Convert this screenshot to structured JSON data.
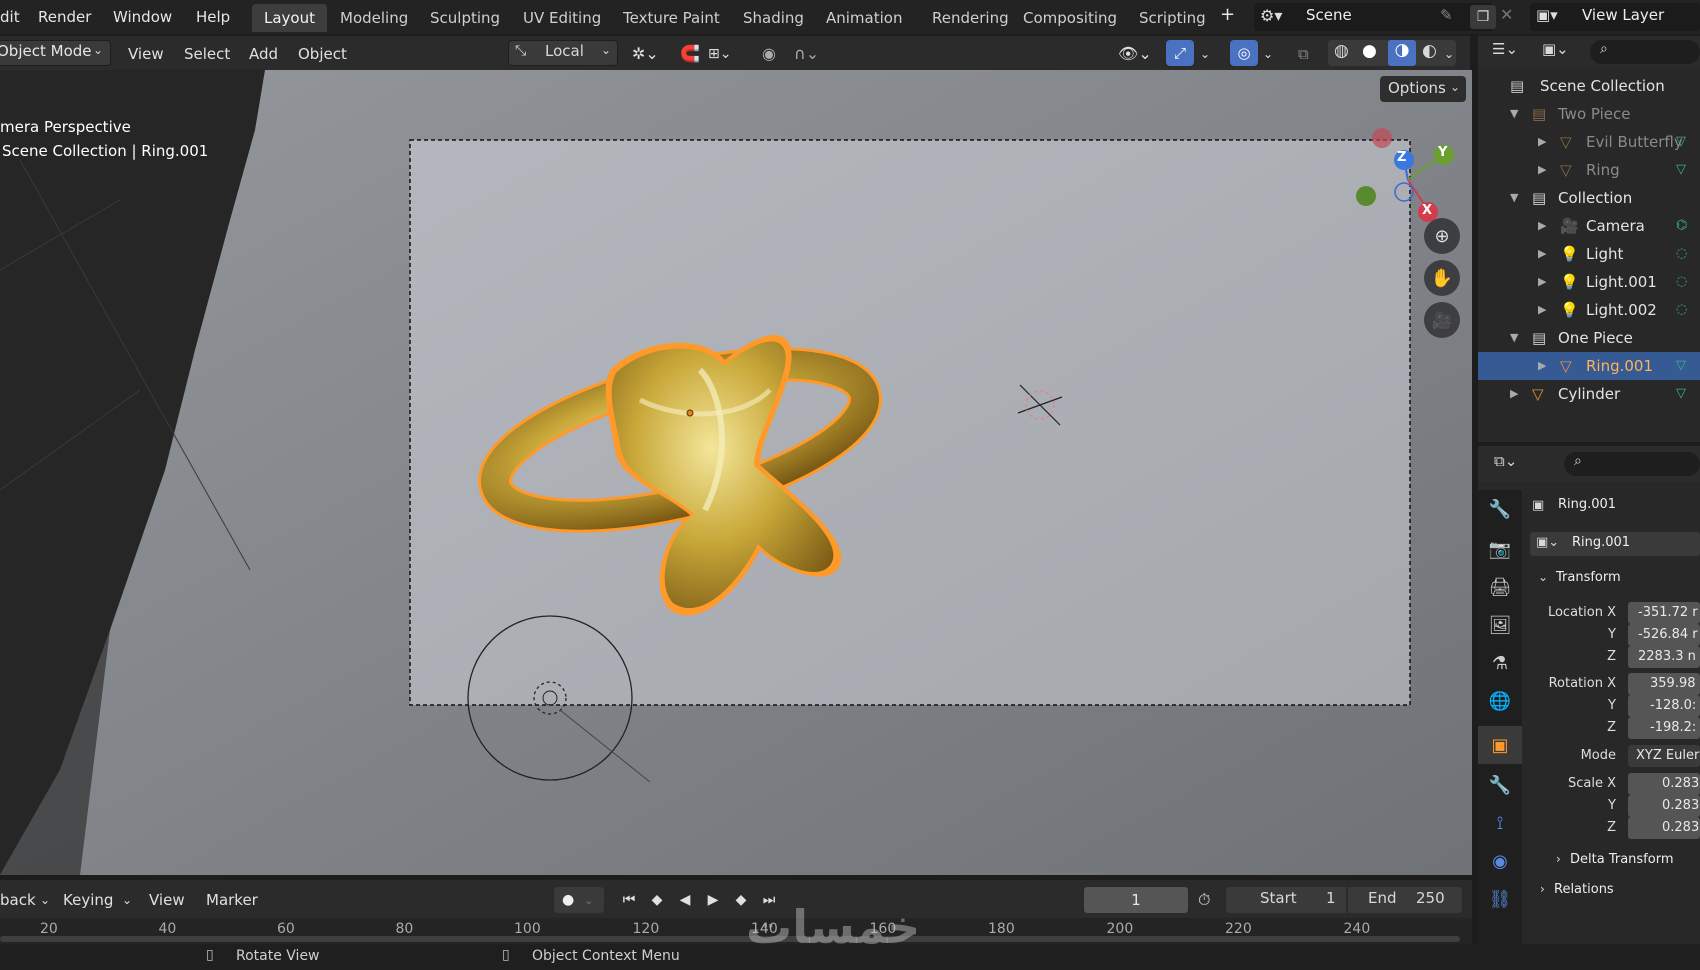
{
  "top_menu": [
    "dit",
    "Render",
    "Window",
    "Help"
  ],
  "workspaces": [
    "Layout",
    "Modeling",
    "Sculpting",
    "UV Editing",
    "Texture Paint",
    "Shading",
    "Animation",
    "Rendering",
    "Compositing",
    "Scripting"
  ],
  "active_workspace": "Layout",
  "scene_name": "Scene",
  "view_layer": "View Layer",
  "header": {
    "mode": "Object Mode",
    "menus": [
      "View",
      "Select",
      "Add",
      "Object"
    ],
    "pivot": "Local",
    "options": "Options"
  },
  "viewport": {
    "line1": "mera Perspective",
    "line2": "Scene Collection | Ring.001",
    "gizmo_z": "Z",
    "gizmo_y": "Y",
    "gizmo_x": "X"
  },
  "outliner": {
    "root": "Scene Collection",
    "rows": [
      {
        "label": "Two Piece",
        "kind": "collection",
        "indent": 0,
        "dim": true
      },
      {
        "label": "Evil Butterfly",
        "kind": "mesh",
        "indent": 1,
        "dim": true
      },
      {
        "label": "Ring",
        "kind": "mesh",
        "indent": 1,
        "dim": true
      },
      {
        "label": "Collection",
        "kind": "collection",
        "indent": 0,
        "dim": false
      },
      {
        "label": "Camera",
        "kind": "camera",
        "indent": 1,
        "dim": false
      },
      {
        "label": "Light",
        "kind": "light",
        "indent": 1,
        "dim": false
      },
      {
        "label": "Light.001",
        "kind": "light",
        "indent": 1,
        "dim": false
      },
      {
        "label": "Light.002",
        "kind": "light",
        "indent": 1,
        "dim": false
      },
      {
        "label": "One Piece",
        "kind": "collection",
        "indent": 0,
        "dim": false
      },
      {
        "label": "Ring.001",
        "kind": "mesh",
        "indent": 1,
        "dim": false,
        "selected": true
      },
      {
        "label": "Cylinder",
        "kind": "mesh",
        "indent": 0,
        "dim": false
      }
    ]
  },
  "properties": {
    "object_name": "Ring.001",
    "data_name": "Ring.001",
    "panel": "Transform",
    "location_label": "Location X",
    "location": [
      "-351.72 r",
      "-526.84 r",
      "2283.3 n"
    ],
    "rotation_label": "Rotation X",
    "rotation": [
      "359.98",
      "-128.0:",
      "-198.2:"
    ],
    "mode_label": "Mode",
    "mode_value": "XYZ Euler",
    "scale_label": "Scale X",
    "scale": [
      "0.283",
      "0.283",
      "0.283"
    ],
    "axis_y": "Y",
    "axis_z": "Z",
    "delta": "Delta Transform",
    "relations": "Relations"
  },
  "timeline": {
    "playback": "back",
    "keying": "Keying",
    "view": "View",
    "marker": "Marker",
    "current_frame": "1",
    "start_label": "Start",
    "start": "1",
    "end_label": "End",
    "end": "250",
    "ruler": [
      "20",
      "40",
      "60",
      "80",
      "100",
      "120",
      "140",
      "160",
      "180",
      "200",
      "220",
      "240"
    ]
  },
  "status": {
    "left_hint": "Rotate View",
    "middle_hint": "Object Context Menu"
  },
  "watermark": "خمسات",
  "colors": {
    "accent_blue": "#4a72c0",
    "selection_orange": "#ff9a2a",
    "outliner_selected": "#355a94",
    "gold": "#c9a83a"
  }
}
